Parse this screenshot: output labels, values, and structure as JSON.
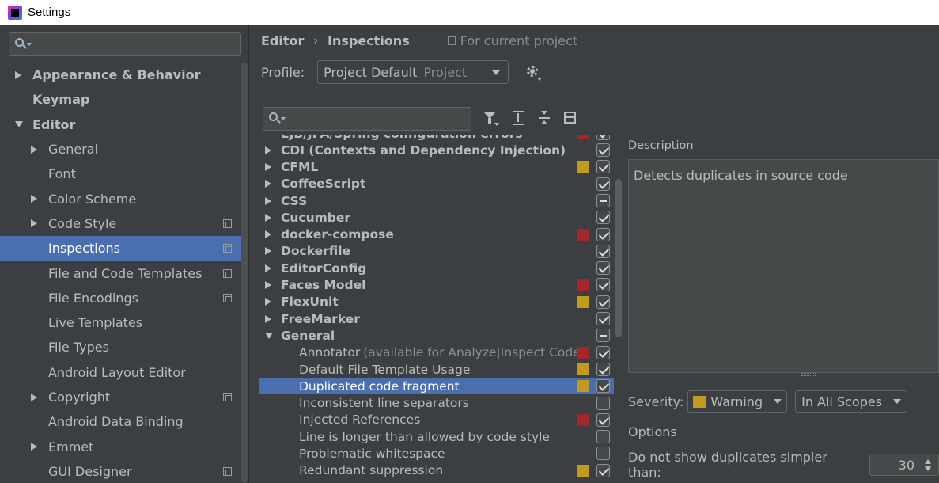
{
  "window": {
    "title": "Settings"
  },
  "sidebar": {
    "search_placeholder": "",
    "items": [
      {
        "label": "Appearance & Behavior",
        "level": 0,
        "bold": true,
        "arrow": "right",
        "copy": false,
        "selected": false
      },
      {
        "label": "Keymap",
        "level": 0,
        "bold": true,
        "arrow": "none",
        "copy": false,
        "selected": false
      },
      {
        "label": "Editor",
        "level": 0,
        "bold": true,
        "arrow": "down",
        "copy": false,
        "selected": false
      },
      {
        "label": "General",
        "level": 1,
        "bold": false,
        "arrow": "right",
        "copy": false,
        "selected": false
      },
      {
        "label": "Font",
        "level": 1,
        "bold": false,
        "arrow": "none",
        "copy": false,
        "selected": false
      },
      {
        "label": "Color Scheme",
        "level": 1,
        "bold": false,
        "arrow": "right",
        "copy": false,
        "selected": false
      },
      {
        "label": "Code Style",
        "level": 1,
        "bold": false,
        "arrow": "right",
        "copy": true,
        "selected": false
      },
      {
        "label": "Inspections",
        "level": 1,
        "bold": false,
        "arrow": "none",
        "copy": true,
        "selected": true
      },
      {
        "label": "File and Code Templates",
        "level": 1,
        "bold": false,
        "arrow": "none",
        "copy": true,
        "selected": false
      },
      {
        "label": "File Encodings",
        "level": 1,
        "bold": false,
        "arrow": "none",
        "copy": true,
        "selected": false
      },
      {
        "label": "Live Templates",
        "level": 1,
        "bold": false,
        "arrow": "none",
        "copy": false,
        "selected": false
      },
      {
        "label": "File Types",
        "level": 1,
        "bold": false,
        "arrow": "none",
        "copy": false,
        "selected": false
      },
      {
        "label": "Android Layout Editor",
        "level": 1,
        "bold": false,
        "arrow": "none",
        "copy": false,
        "selected": false
      },
      {
        "label": "Copyright",
        "level": 1,
        "bold": false,
        "arrow": "right",
        "copy": true,
        "selected": false
      },
      {
        "label": "Android Data Binding",
        "level": 1,
        "bold": false,
        "arrow": "none",
        "copy": false,
        "selected": false
      },
      {
        "label": "Emmet",
        "level": 1,
        "bold": false,
        "arrow": "right",
        "copy": false,
        "selected": false
      },
      {
        "label": "GUI Designer",
        "level": 1,
        "bold": false,
        "arrow": "none",
        "copy": true,
        "selected": false
      }
    ]
  },
  "header": {
    "crumbs": [
      "Editor",
      "Inspections"
    ],
    "scope_hint": "For current project"
  },
  "profile": {
    "label": "Profile:",
    "value": "Project Default",
    "sub": "Project"
  },
  "inspections": {
    "search_placeholder": "",
    "partial_top": "EJB/JPA/Spring configuration errors",
    "rows": [
      {
        "label": "CDI (Contexts and Dependency Injection)",
        "type": "group",
        "severity": "",
        "check": "checked"
      },
      {
        "label": "CFML",
        "type": "group",
        "severity": "#c29a1f",
        "check": "checked"
      },
      {
        "label": "CoffeeScript",
        "type": "group",
        "severity": "",
        "check": "checked"
      },
      {
        "label": "CSS",
        "type": "group",
        "severity": "",
        "check": "partial"
      },
      {
        "label": "Cucumber",
        "type": "group",
        "severity": "",
        "check": "checked"
      },
      {
        "label": "docker-compose",
        "type": "group",
        "severity": "#a3272a",
        "check": "checked"
      },
      {
        "label": "Dockerfile",
        "type": "group",
        "severity": "",
        "check": "checked"
      },
      {
        "label": "EditorConfig",
        "type": "group",
        "severity": "",
        "check": "checked"
      },
      {
        "label": "Faces Model",
        "type": "group",
        "severity": "#a3272a",
        "check": "checked"
      },
      {
        "label": "FlexUnit",
        "type": "group",
        "severity": "#c29a1f",
        "check": "checked"
      },
      {
        "label": "FreeMarker",
        "type": "group",
        "severity": "",
        "check": "checked"
      },
      {
        "label": "General",
        "type": "group-open",
        "severity": "",
        "check": "partial"
      },
      {
        "label": "Annotator",
        "note": "(available for Analyze|Inspect Code)",
        "type": "child",
        "severity": "#a3272a",
        "check": "checked"
      },
      {
        "label": "Default File Template Usage",
        "type": "child",
        "severity": "#c29a1f",
        "check": "checked"
      },
      {
        "label": "Duplicated code fragment",
        "type": "child",
        "severity": "#c29a1f",
        "check": "checked",
        "selected": true
      },
      {
        "label": "Inconsistent line separators",
        "type": "child",
        "severity": "",
        "check": "empty"
      },
      {
        "label": "Injected References",
        "type": "child",
        "severity": "#a3272a",
        "check": "checked"
      },
      {
        "label": "Line is longer than allowed by code style",
        "type": "child",
        "severity": "",
        "check": "empty"
      },
      {
        "label": "Problematic whitespace",
        "type": "child",
        "severity": "",
        "check": "empty"
      },
      {
        "label": "Redundant suppression",
        "type": "child",
        "severity": "#c29a1f",
        "check": "checked"
      }
    ]
  },
  "description": {
    "title": "Description",
    "text": "Detects duplicates in source code"
  },
  "severity": {
    "label": "Severity:",
    "value": "Warning",
    "color": "#c29a1f",
    "scope": "In All Scopes"
  },
  "options": {
    "title": "Options",
    "dup_label": "Do not show duplicates simpler than:",
    "dup_value": "30"
  }
}
